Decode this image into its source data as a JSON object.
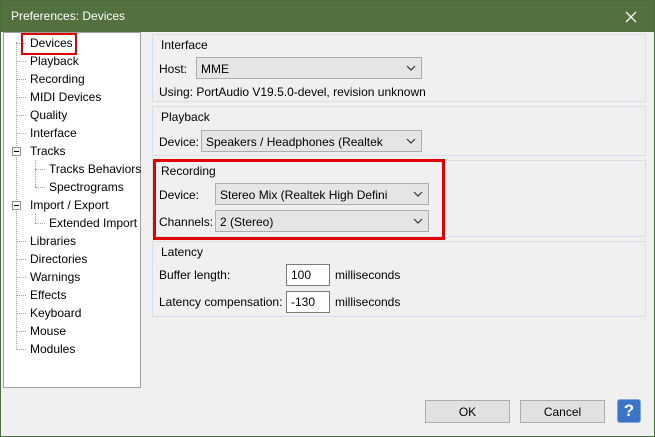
{
  "window": {
    "title": "Preferences: Devices"
  },
  "tree": {
    "items": [
      {
        "label": "Devices",
        "selected": true
      },
      {
        "label": "Playback"
      },
      {
        "label": "Recording"
      },
      {
        "label": "MIDI Devices"
      },
      {
        "label": "Quality"
      },
      {
        "label": "Interface"
      },
      {
        "label": "Tracks",
        "expanded": true
      },
      {
        "label": "Tracks Behaviors"
      },
      {
        "label": "Spectrograms"
      },
      {
        "label": "Import / Export",
        "expanded": true
      },
      {
        "label": "Extended Import"
      },
      {
        "label": "Libraries"
      },
      {
        "label": "Directories"
      },
      {
        "label": "Warnings"
      },
      {
        "label": "Effects"
      },
      {
        "label": "Keyboard"
      },
      {
        "label": "Mouse"
      },
      {
        "label": "Modules"
      }
    ]
  },
  "interface": {
    "title": "Interface",
    "host_label": "Host:",
    "host_value": "MME",
    "using_text": "Using: PortAudio V19.5.0-devel, revision unknown"
  },
  "playback": {
    "title": "Playback",
    "device_label": "Device:",
    "device_value": "Speakers / Headphones (Realtek"
  },
  "recording": {
    "title": "Recording",
    "device_label": "Device:",
    "device_value": "Stereo Mix (Realtek High Defini",
    "channels_label": "Channels:",
    "channels_value": "2 (Stereo)"
  },
  "latency": {
    "title": "Latency",
    "buffer_label": "Buffer length:",
    "buffer_value": "100",
    "buffer_unit": "milliseconds",
    "comp_label": "Latency compensation:",
    "comp_value": "-130",
    "comp_unit": "milliseconds"
  },
  "buttons": {
    "ok": "OK",
    "cancel": "Cancel",
    "help": "?"
  },
  "colors": {
    "titlebar": "#53703f",
    "highlight": "#e00000",
    "help": "#3b74c6"
  }
}
